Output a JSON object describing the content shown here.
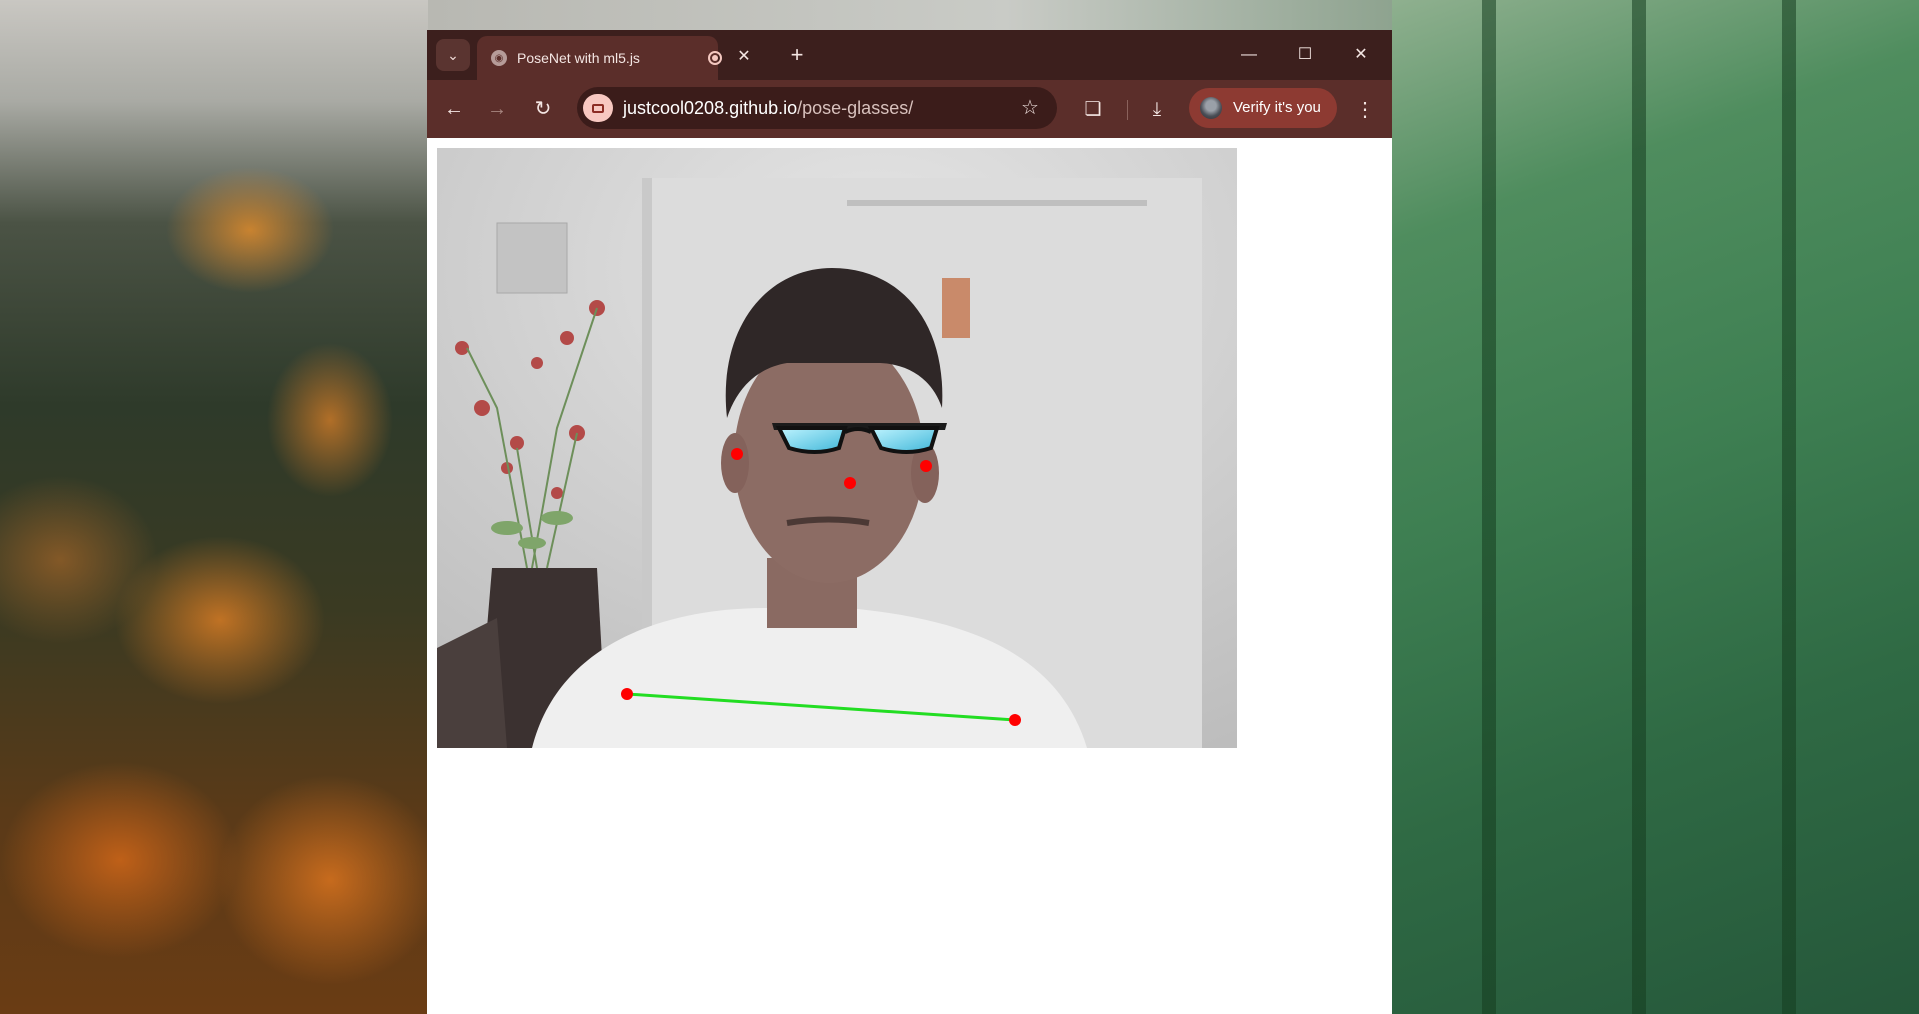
{
  "browser": {
    "tab_title": "PoseNet with ml5.js",
    "url_host": "justcool0208.github.io",
    "url_path": "/pose-glasses/",
    "profile_button_label": "Verify it's you"
  },
  "icons": {
    "tab_search": "chevron-down-icon",
    "favicon": "globe-icon",
    "recording": "record-icon",
    "tab_close": "close-icon",
    "new_tab": "plus-icon",
    "minimize": "minimize-icon",
    "maximize": "maximize-icon",
    "close": "close-icon",
    "back": "arrow-left-icon",
    "forward": "arrow-right-icon",
    "reload": "reload-icon",
    "site_info": "camera-icon",
    "bookmark": "star-icon",
    "extensions": "puzzle-icon",
    "downloads": "download-icon",
    "menu": "kebab-menu-icon"
  },
  "colors": {
    "tabstrip": "#3c1f1d",
    "toolbar": "#5b2e2a",
    "verify_button": "#8d3a32",
    "keypoint": "#ff0000",
    "skeleton": "#22dd22"
  },
  "pose": {
    "keypoints": [
      "left-ear",
      "right-ear",
      "nose",
      "left-shoulder",
      "right-shoulder"
    ],
    "overlay": "glasses"
  }
}
